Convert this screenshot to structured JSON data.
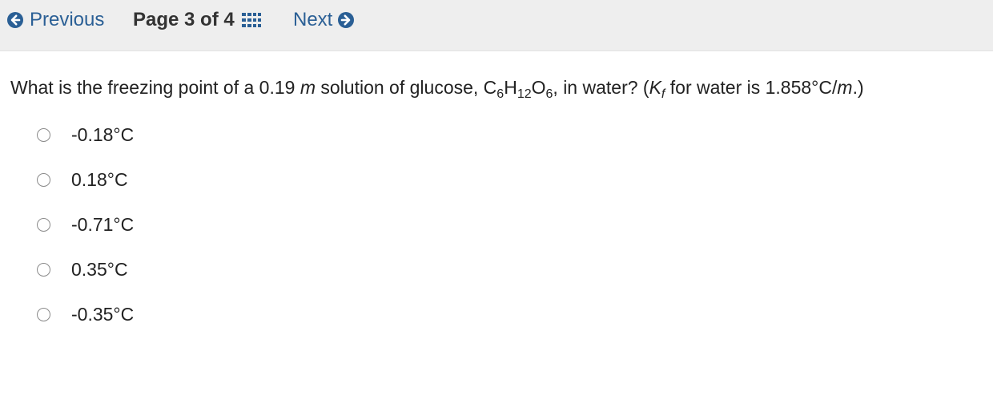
{
  "nav": {
    "previous_label": "Previous",
    "page_label": "Page 3 of 4",
    "next_label": "Next",
    "link_color": "#2a5f95",
    "icons": {
      "previous": "arrow-circle-left-icon",
      "page": "grid-icon",
      "next": "arrow-circle-right-icon"
    }
  },
  "question": {
    "q1": "What is the freezing point of a 0.19 ",
    "m_unit": "m",
    "q2": " solution of glucose, C",
    "s1": "6",
    "h": "H",
    "s2": "12",
    "o": "O",
    "s3": "6",
    "q3": ", in water? (",
    "k": "K",
    "kf_sub": "f",
    "q4": " for water is 1.858°C/",
    "m_unit2": "m",
    "q5": ".)"
  },
  "options": [
    {
      "label": "-0.18°C",
      "selected": false
    },
    {
      "label": "0.18°C",
      "selected": false
    },
    {
      "label": "-0.71°C",
      "selected": false
    },
    {
      "label": "0.35°C",
      "selected": false
    },
    {
      "label": "-0.35°C",
      "selected": false
    }
  ]
}
